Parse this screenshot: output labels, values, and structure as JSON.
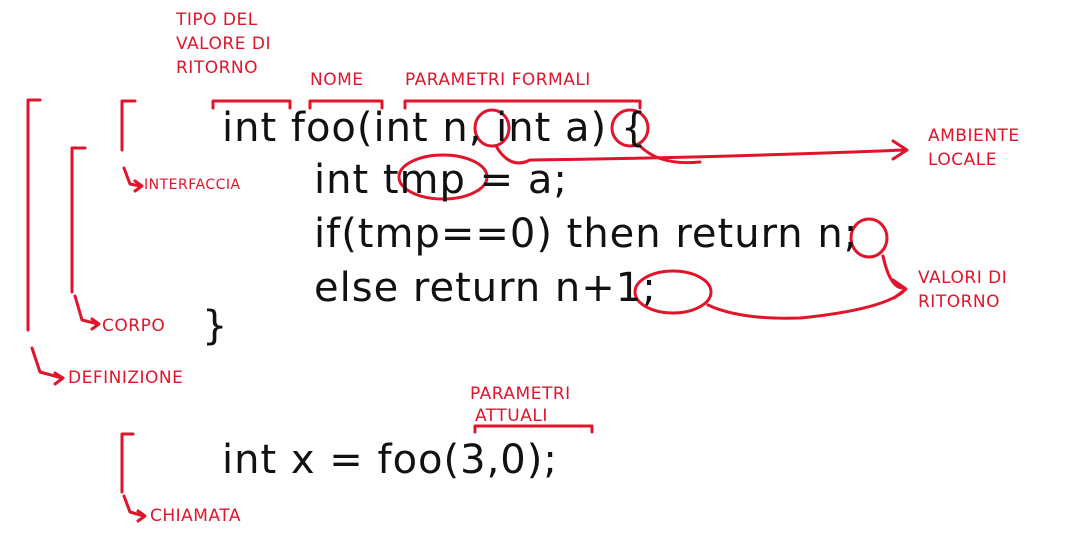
{
  "colors": {
    "ink": "#111111",
    "annotation": "#e0142a"
  },
  "code": {
    "line1": "int foo(int n, int a) {",
    "line2": "int tmp = a;",
    "line3": "if(tmp==0) then return n;",
    "line4": "else return n+1;",
    "line5": "}",
    "call": "int x = foo(3,0);"
  },
  "labels": {
    "return_type_1": "TIPO DEL",
    "return_type_2": "VALORE DI",
    "return_type_3": "RITORNO",
    "name": "NOME",
    "formal_params": "PARAMETRI FORMALI",
    "local_env_1": "AMBIENTE",
    "local_env_2": "LOCALE",
    "interface": "INTERFACCIA",
    "return_values_1": "VALORI DI",
    "return_values_2": "RITORNO",
    "body": "CORPO",
    "definition": "DEFINIZIONE",
    "actual_params_1": "PARAMETRI",
    "actual_params_2": "ATTUALI",
    "call": "CHIAMATA"
  }
}
